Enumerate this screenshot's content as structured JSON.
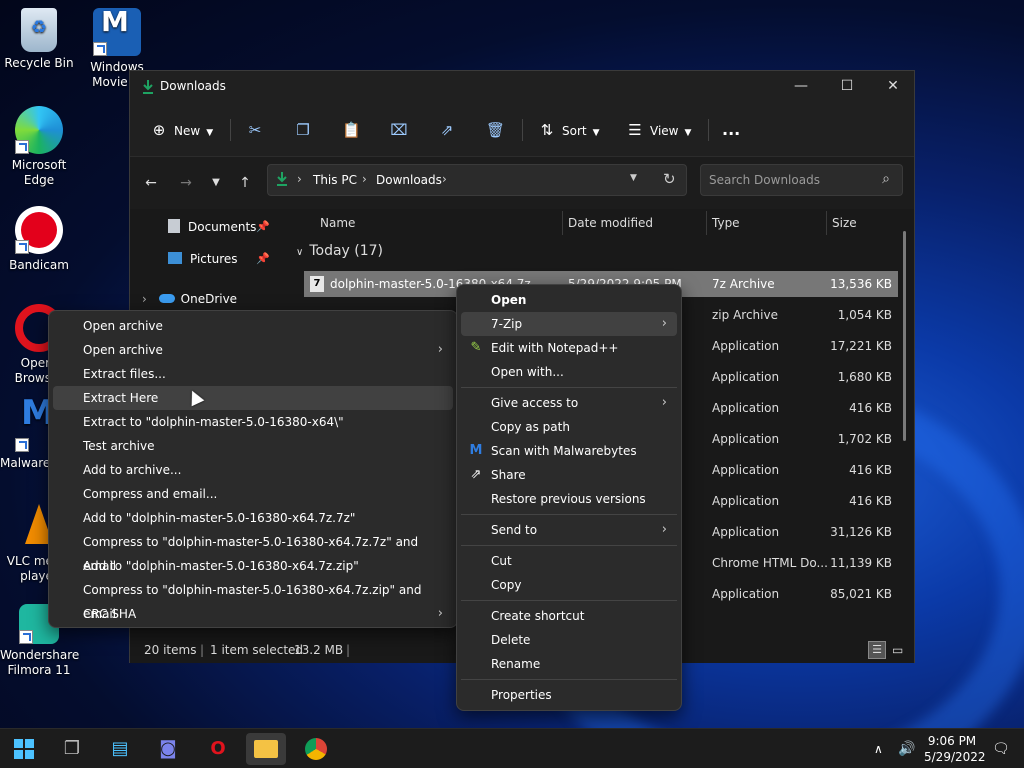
{
  "desktop": {
    "icons": [
      {
        "label": "Recycle Bin"
      },
      {
        "label": "Windows Movie M"
      },
      {
        "label": "Microsoft Edge"
      },
      {
        "label": "Bandicam"
      },
      {
        "label": "Opera Browser"
      },
      {
        "label": "Malwarebytes"
      },
      {
        "label": "VLC media player"
      },
      {
        "label": "Wondershare Filmora 11"
      }
    ]
  },
  "window": {
    "title": "Downloads",
    "commands": {
      "new": "New",
      "sort": "Sort",
      "view": "View",
      "more": "..."
    },
    "address": {
      "crumbs": [
        "This PC",
        "Downloads"
      ]
    },
    "search": {
      "placeholder": "Search Downloads"
    },
    "nav_items": [
      "Documents",
      "Pictures",
      "OneDrive"
    ],
    "columns": [
      "Name",
      "Date modified",
      "Type",
      "Size"
    ],
    "group_header": "Today (17)",
    "rows": [
      {
        "name": "dolphin-master-5.0-16380-x64.7z",
        "date": "5/29/2022 9:05 PM",
        "type": "7z Archive",
        "size": "13,536 KB"
      },
      {
        "name": "",
        "date": "",
        "type": "zip Archive",
        "size": "1,054 KB"
      },
      {
        "name": "",
        "date": "",
        "type": "Application",
        "size": "17,221 KB"
      },
      {
        "name": "",
        "date": "",
        "type": "Application",
        "size": "1,680 KB"
      },
      {
        "name": "",
        "date": "",
        "type": "Application",
        "size": "416 KB"
      },
      {
        "name": "",
        "date": "",
        "type": "Application",
        "size": "1,702 KB"
      },
      {
        "name": "",
        "date": "",
        "type": "Application",
        "size": "416 KB"
      },
      {
        "name": "",
        "date": "",
        "type": "Application",
        "size": "416 KB"
      },
      {
        "name": "",
        "date": "",
        "type": "Application",
        "size": "31,126 KB"
      },
      {
        "name": "",
        "date": "",
        "type": "Chrome HTML Do...",
        "size": "11,139 KB"
      },
      {
        "name": "",
        "date": "",
        "type": "Application",
        "size": "85,021 KB"
      }
    ],
    "status": {
      "items": "20 items",
      "selected": "1 item selected",
      "size": "13.2 MB"
    }
  },
  "context_menu": {
    "items": [
      "Open",
      "7-Zip",
      "Edit with Notepad++",
      "Open with...",
      "Give access to",
      "Copy as path",
      "Scan with Malwarebytes",
      "Share",
      "Restore previous versions",
      "Send to",
      "Cut",
      "Copy",
      "Create shortcut",
      "Delete",
      "Rename",
      "Properties"
    ]
  },
  "sevenzip_menu": {
    "items": [
      "Open archive",
      "Open archive",
      "Extract files...",
      "Extract Here",
      "Extract to \"dolphin-master-5.0-16380-x64\\\"",
      "Test archive",
      "Add to archive...",
      "Compress and email...",
      "Add to \"dolphin-master-5.0-16380-x64.7z.7z\"",
      "Compress to \"dolphin-master-5.0-16380-x64.7z.7z\" and email",
      "Add to \"dolphin-master-5.0-16380-x64.7z.zip\"",
      "Compress to \"dolphin-master-5.0-16380-x64.7z.zip\" and email",
      "CRC SHA"
    ]
  },
  "taskbar": {
    "time": "9:06 PM",
    "date": "5/29/2022"
  },
  "colors": {
    "accent": "#1ea362",
    "menu_bg": "#2b2b2b",
    "selected_row": "#777777"
  }
}
